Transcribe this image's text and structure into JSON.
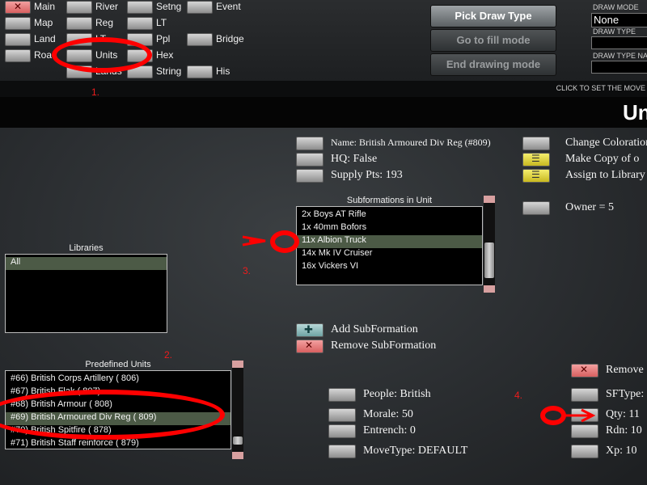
{
  "toolbar": {
    "col1": [
      {
        "label": "Main",
        "x": true
      },
      {
        "label": "Map",
        "x": false
      },
      {
        "label": "Land",
        "x": false
      },
      {
        "label": "Road",
        "x": false
      }
    ],
    "col2": [
      "River",
      "Reg",
      "LT",
      "Units",
      "Lands"
    ],
    "col3": [
      "Setng",
      "LT",
      "Ppl",
      "Hex",
      "String"
    ],
    "col4": [
      "Event",
      "Bridge",
      "His"
    ],
    "pick_draw_type": "Pick Draw Type",
    "go_to_fill_mode": "Go to fill mode",
    "end_drawing_mode": "End drawing mode",
    "draw_mode_label": "DRAW MODE",
    "draw_mode_value": "None",
    "draw_type_label": "DRAW TYPE",
    "draw_type_name_label": "DRAW TYPE NAME"
  },
  "hint": "CLICK TO SET THE MOVE",
  "page_title": "Uni",
  "unit": {
    "name": "Name: British Armoured Div Reg (#809)",
    "hq": "HQ: False",
    "supply": "Supply Pts:  193",
    "change_coloration": "Change Coloration",
    "make_copy": "Make Copy of o",
    "assign_library": "Assign to Library",
    "owner": "Owner =  5"
  },
  "subformations": {
    "title": "Subformations in Unit",
    "items": [
      "2x Boys AT Rifle",
      "1x 40mm Bofors",
      "11x Albion Truck",
      "14x Mk IV Cruiser",
      "16x Vickers VI"
    ],
    "selected_index": 2,
    "add": "Add SubFormation",
    "remove": "Remove SubFormation"
  },
  "libraries": {
    "title": "Libraries",
    "items": [
      "All"
    ]
  },
  "predefined": {
    "title": "Predefined Units",
    "items": [
      "#66) British Corps Artillery ( 806)",
      "#67) British Flak ( 807)",
      "#68) British Armour ( 808)",
      "#69) British Armoured Div Reg ( 809)",
      "#70) British Spitfire ( 878)",
      "#71) British Staff reinforce ( 879)"
    ],
    "selected_index": 3
  },
  "props": {
    "people": "People: British",
    "morale": "Morale:  50",
    "entrench": "Entrench:  0",
    "movetype": "MoveType: DEFAULT"
  },
  "sf": {
    "remove": "Remove",
    "sftype": "SFType:",
    "qty": "Qty:  11",
    "rdn": "Rdn:  10",
    "xp": "Xp:  10"
  },
  "annotations": [
    "1.",
    "2.",
    "3.",
    "4."
  ]
}
